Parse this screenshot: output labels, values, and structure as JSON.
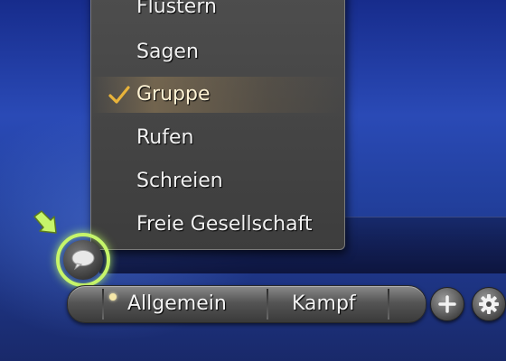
{
  "chat_mode_menu": {
    "items": [
      {
        "label": "Flüstern",
        "selected": false
      },
      {
        "label": "Sagen",
        "selected": false
      },
      {
        "label": "Gruppe",
        "selected": true
      },
      {
        "label": "Rufen",
        "selected": false
      },
      {
        "label": "Schreien",
        "selected": false
      },
      {
        "label": "Freie Gesellschaft",
        "selected": false
      }
    ]
  },
  "chat_tabs": {
    "tab_general": "Allgemein",
    "tab_combat": "Kampf"
  },
  "icons": {
    "chat_mode_button": "speech-bubble-icon",
    "hint": "arrow-pointer-icon",
    "add": "plus-icon",
    "settings": "gear-icon",
    "selected_mark": "checkmark-icon"
  },
  "colors": {
    "highlight_ring": "#c6f56a",
    "check": "#e8b33a",
    "background_blue": "#2a4ab6"
  }
}
